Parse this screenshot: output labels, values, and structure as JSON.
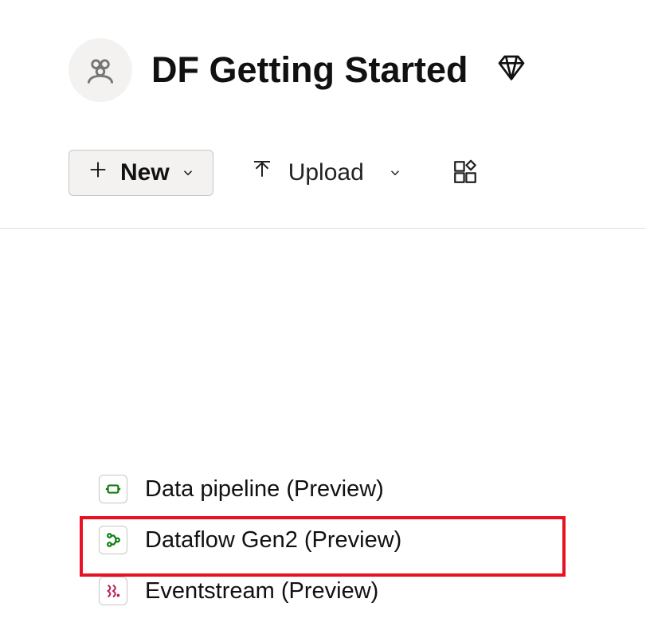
{
  "workspace": {
    "title": "DF Getting Started"
  },
  "toolbar": {
    "new_label": "New",
    "upload_label": "Upload"
  },
  "menu": {
    "items": [
      {
        "label": "Data pipeline (Preview)"
      },
      {
        "label": "Dataflow Gen2 (Preview)"
      },
      {
        "label": "Eventstream (Preview)"
      }
    ]
  }
}
